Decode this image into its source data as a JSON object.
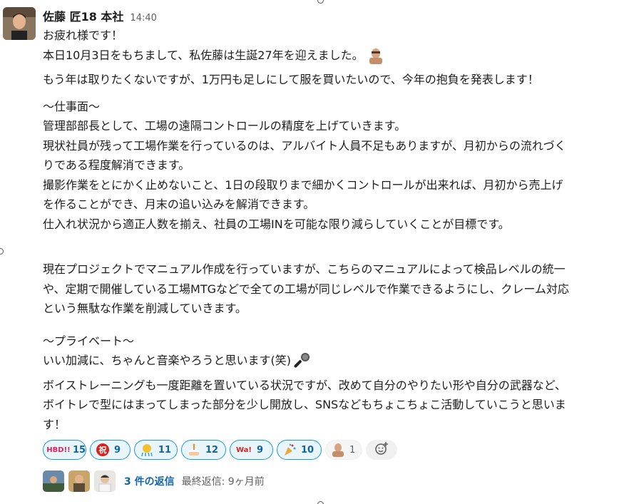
{
  "author": "佐藤 匠18 本社",
  "time": "14:40",
  "lines": {
    "l1": "お疲れ様です！",
    "l2": "本日10月3日をもちまして、私佐藤は生誕27年を迎えました。",
    "l3": "もう年は取りたくないですが、1万円も足しにして服を買いたいので、今年の抱負を発表します！",
    "l4": "〜仕事面〜",
    "l5": "管理部部長として、工場の遠隔コントロールの精度を上げていきます。",
    "l6": "現状社員が残って工場作業を行っているのは、アルバイト人員不足もありますが、月初からの流れづく",
    "l7": "りである程度解消できます。",
    "l8": "撮影作業をとにかく止めないこと、1日の段取りまで細かくコントロールが出来れば、月初から売上げ",
    "l9": "を作ることができ、月末の追い込みを解消できます。",
    "l10": "仕入れ状況から適正人数を揃え、社員の工場INを可能な限り減らしていくことが目標です。",
    "l11": "現在プロジェクトでマニュアル作成を行っていますが、こちらのマニュアルによって検品レベルの統一",
    "l12": "や、定期で開催している工場MTGなどで全ての工場が同じレベルで作業できるようにし、クレーム対応",
    "l13": "という無駄な作業を削減していきます。",
    "l14": "〜プライベート〜",
    "l15": "いい加減に、ちゃんと音楽やろうと思います(笑)",
    "l16": "ボイストレーニングも一度距離を置いている状況ですが、改めて自分のやりたい形や自分の武器など、",
    "l17": "ボイトレで型にはまってしまった部分を少し開放し、SNSなどもちょこちょこ活動していこうと思いま",
    "l18": "す！"
  },
  "reactions": [
    {
      "icon": "hbd-text-emoji",
      "label": "HBD!!",
      "count": "15"
    },
    {
      "icon": "celebration-red-emoji",
      "label": "祝",
      "count": "9"
    },
    {
      "icon": "confetti-ball-emoji",
      "label": "🎊",
      "count": "11"
    },
    {
      "icon": "birthday-cake-emoji",
      "label": "🎂",
      "count": "12"
    },
    {
      "icon": "wow-text-emoji",
      "label": "Wa!",
      "count": "9"
    },
    {
      "icon": "party-popper-emoji",
      "label": "🎉",
      "count": "10"
    },
    {
      "icon": "person-photo-emoji",
      "label": "",
      "count": "1"
    }
  ],
  "thread": {
    "replies": "3 件の返信",
    "last_reply": "最終返信: 9ヶ月前"
  },
  "colors": {
    "link": "#1264a3",
    "reaction_border": "#1d9bd1",
    "reaction_bg": "#e8f5fa"
  }
}
